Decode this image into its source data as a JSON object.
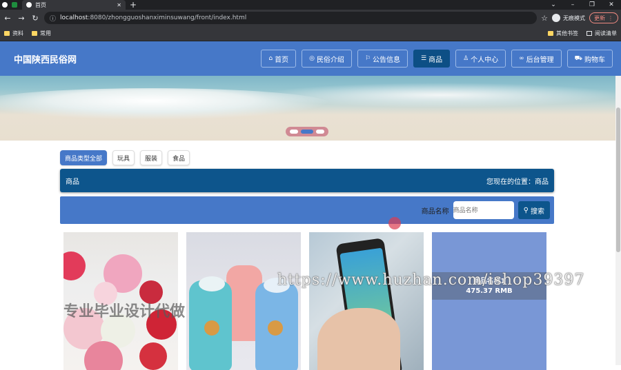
{
  "browser": {
    "tab_title": "首页",
    "url_host": "localhost",
    "url_rest": ":8080/zhongguoshanximinsuwang/front/index.html",
    "profile_label": "无痕模式",
    "update_label": "更新",
    "bookmarks": [
      "资料",
      "常用"
    ],
    "bookmarks_right": [
      "其他书签",
      "阅读清单"
    ]
  },
  "site": {
    "title": "中国陕西民俗网",
    "nav": [
      {
        "label": "首页",
        "icon": "home-icon",
        "glyph": "⌂"
      },
      {
        "label": "民俗介绍",
        "icon": "globe-icon",
        "glyph": "◎"
      },
      {
        "label": "公告信息",
        "icon": "flag-icon",
        "glyph": "⚐"
      },
      {
        "label": "商品",
        "icon": "list-icon",
        "glyph": "☰",
        "active": true
      },
      {
        "label": "个人中心",
        "icon": "user-icon",
        "glyph": "♙"
      },
      {
        "label": "后台管理",
        "icon": "link-icon",
        "glyph": "∞"
      },
      {
        "label": "购物车",
        "icon": "cart-icon",
        "glyph": "⛟"
      }
    ]
  },
  "categories": [
    "商品类型全部",
    "玩具",
    "服装",
    "食品"
  ],
  "breadcrumb": {
    "left": "商品",
    "right": "您现在的位置：商品"
  },
  "search": {
    "label": "商品名称",
    "placeholder": "商品名称",
    "button": "搜索"
  },
  "products": [
    {
      "image": "flowers"
    },
    {
      "image": "cups"
    },
    {
      "image": "phone"
    },
    {
      "image": "blue",
      "name": "商品名称1",
      "price": "475.37 RMB"
    }
  ],
  "watermarks": {
    "url": "https://www.huzhan.com/ishop39397",
    "text": "专业毕业设计代做"
  },
  "colors": {
    "header": "#4678c8",
    "accent_dark": "#0d558c"
  }
}
